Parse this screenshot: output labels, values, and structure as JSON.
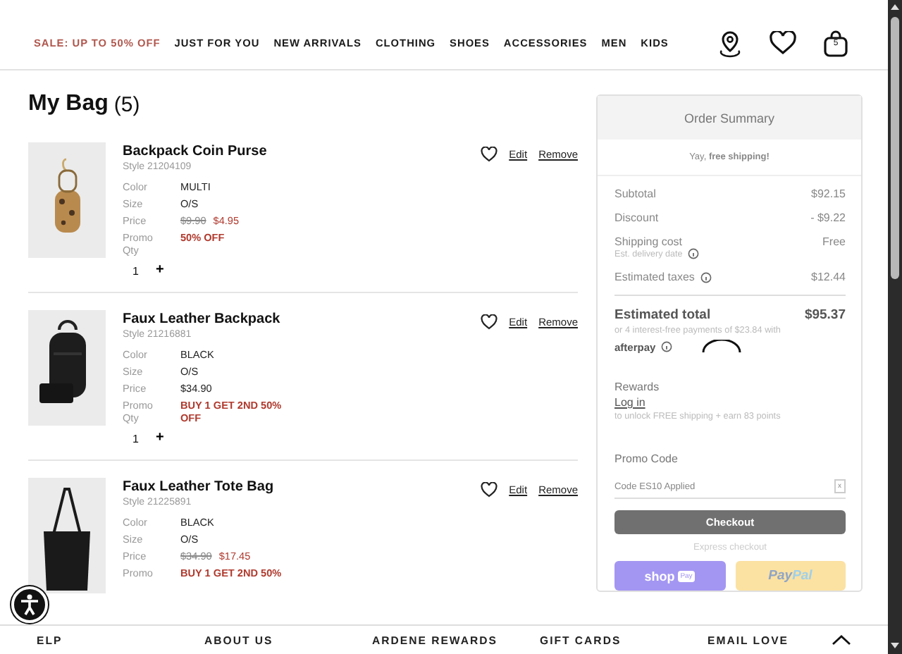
{
  "nav": [
    {
      "label": "SALE: UP TO 50% OFF",
      "kind": "sale"
    },
    {
      "label": "JUST FOR YOU",
      "kind": "link"
    },
    {
      "label": "NEW ARRIVALS",
      "kind": "link"
    },
    {
      "label": "CLOTHING",
      "kind": "link"
    },
    {
      "label": "SHOES",
      "kind": "link"
    },
    {
      "label": "ACCESSORIES",
      "kind": "link"
    },
    {
      "label": "MEN",
      "kind": "link"
    },
    {
      "label": "KIDS",
      "kind": "link"
    }
  ],
  "bag_count_badge": "5",
  "bag": {
    "title": "My Bag",
    "count": "(5)"
  },
  "items": [
    {
      "name": "Backpack Coin Purse",
      "style": "Style 21204109",
      "details": [
        {
          "label": "Color",
          "value": "MULTI"
        },
        {
          "label": "Size",
          "value": "O/S"
        }
      ],
      "price_label": "Price",
      "original_price": "$9.90",
      "price": "$4.95",
      "promo_label": "Promo",
      "promo": "50% OFF",
      "qty_label": "Qty",
      "qty": "1",
      "plus": "+",
      "edit": "Edit",
      "remove": "Remove"
    },
    {
      "name": "Faux Leather Backpack",
      "style": "Style 21216881",
      "details": [
        {
          "label": "Color",
          "value": "BLACK"
        },
        {
          "label": "Size",
          "value": "O/S"
        }
      ],
      "price_label": "Price",
      "price": "$34.90",
      "promo_label": "Promo",
      "promo": "BUY 1 GET 2ND 50% OFF",
      "qty_label": "Qty",
      "qty": "1",
      "plus": "+",
      "edit": "Edit",
      "remove": "Remove"
    },
    {
      "name": "Faux Leather Tote Bag",
      "style": "Style 21225891",
      "details": [
        {
          "label": "Color",
          "value": "BLACK"
        },
        {
          "label": "Size",
          "value": "O/S"
        }
      ],
      "price_label": "Price",
      "original_price": "$34.90",
      "price": "$17.45",
      "promo_label": "Promo",
      "promo": "BUY 1 GET 2ND 50%",
      "edit": "Edit",
      "remove": "Remove"
    }
  ],
  "summary": {
    "title": "Order Summary",
    "shipping_note": "Yay, **free shipping!**",
    "lines": [
      {
        "label": "Subtotal",
        "value": "$92.15"
      },
      {
        "label": "Discount",
        "value": "- $9.22"
      },
      {
        "label": "Shipping cost",
        "value": "Free",
        "sub": "Est. delivery date"
      },
      {
        "label": "Estimated taxes",
        "value": "$12.44",
        "info": true
      }
    ],
    "total_label": "Estimated total",
    "total": "$95.37",
    "installments": "or 4 interest-free payments of $23.84 with",
    "afterpay": "afterpay",
    "rewards_title": "Rewards",
    "login": "Log in",
    "rewards_note": "to unlock FREE shipping + earn 83 points",
    "promo_title": "Promo Code",
    "promo_value": "Code ES10 Applied",
    "promo_clear": "x",
    "checkout": "Checkout",
    "express": "Express checkout",
    "shop": "shop",
    "shop_badge": "Pay",
    "paypal_a": "Pay",
    "paypal_b": "Pal"
  },
  "footer": [
    "ELP",
    "ABOUT US",
    "ARDENE REWARDS",
    "GIFT CARDS",
    "EMAIL LOVE"
  ]
}
